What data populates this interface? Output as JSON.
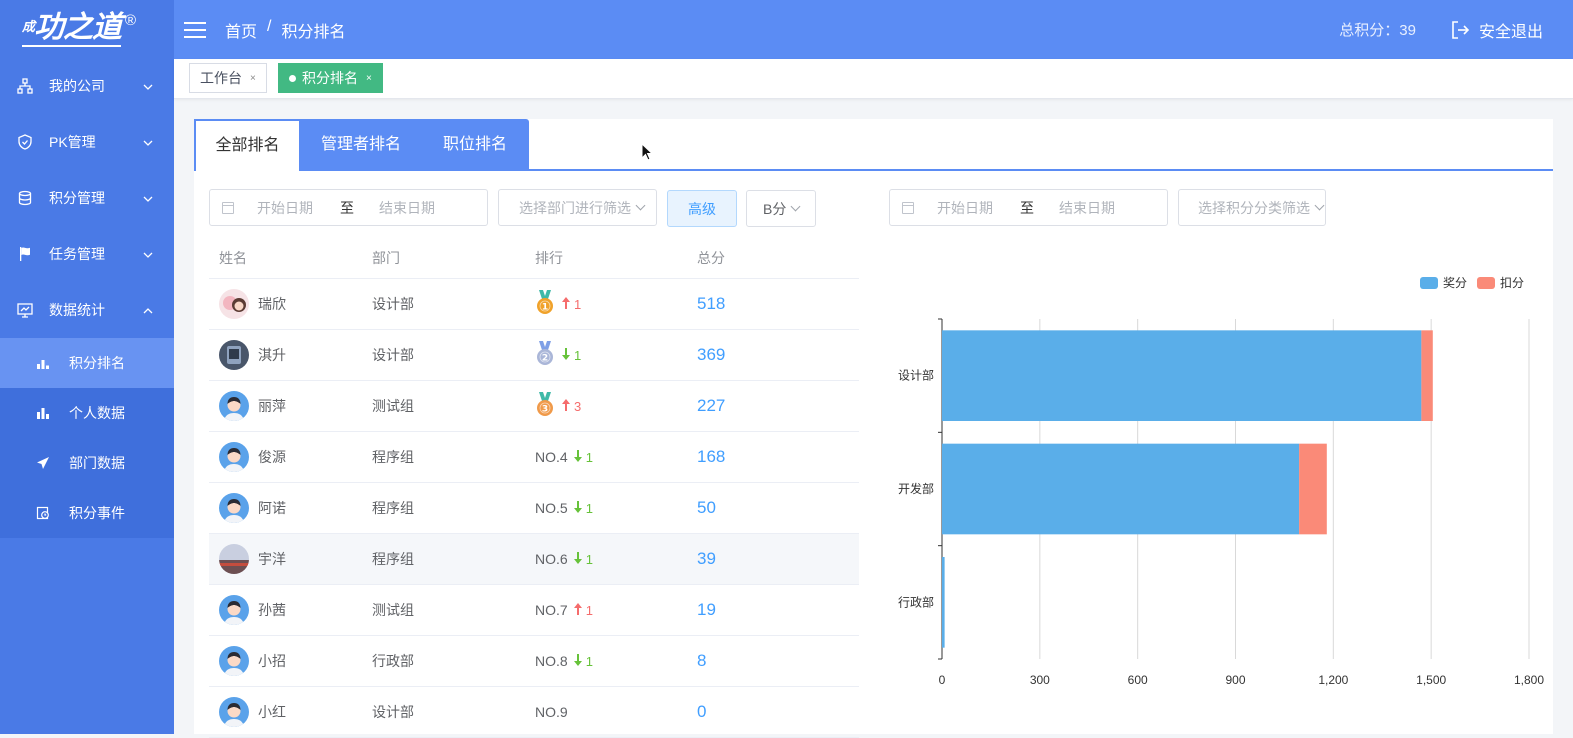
{
  "logo": {
    "text": "功之道",
    "prefix": "成",
    "reg": "®"
  },
  "sidebar": {
    "items": [
      {
        "label": "我的公司",
        "icon": "org-chart-icon"
      },
      {
        "label": "PK管理",
        "icon": "shield-icon"
      },
      {
        "label": "积分管理",
        "icon": "database-icon"
      },
      {
        "label": "任务管理",
        "icon": "flag-icon"
      },
      {
        "label": "数据统计",
        "icon": "dashboard-icon"
      }
    ],
    "subitems": [
      {
        "label": "积分排名",
        "icon": "ranking-icon"
      },
      {
        "label": "个人数据",
        "icon": "bar-chart-icon"
      },
      {
        "label": "部门数据",
        "icon": "send-icon"
      },
      {
        "label": "积分事件",
        "icon": "event-icon"
      }
    ]
  },
  "header": {
    "breadcrumb": [
      "首页",
      "/",
      "积分排名"
    ],
    "total": "总积分：39",
    "logout": "安全退出"
  },
  "tags": [
    {
      "label": "工作台",
      "close": "×"
    },
    {
      "label": "积分排名",
      "close": "×"
    }
  ],
  "tabs": [
    "全部排名",
    "管理者排名",
    "职位排名"
  ],
  "filters": {
    "start": "开始日期",
    "to": "至",
    "end": "结束日期",
    "dept": "选择部门进行筛选",
    "advanced": "高级",
    "type": "B分",
    "category": "选择积分分类筛选"
  },
  "table": {
    "headers": [
      "姓名",
      "部门",
      "排行",
      "总分"
    ],
    "rows": [
      {
        "name": "瑞欣",
        "dept": "设计部",
        "rank": "",
        "medal": "1",
        "trend": "up",
        "change": "1",
        "score": "518"
      },
      {
        "name": "淇升",
        "dept": "设计部",
        "rank": "",
        "medal": "2",
        "trend": "down",
        "change": "1",
        "score": "369"
      },
      {
        "name": "丽萍",
        "dept": "测试组",
        "rank": "",
        "medal": "3",
        "trend": "up",
        "change": "3",
        "score": "227"
      },
      {
        "name": "俊源",
        "dept": "程序组",
        "rank": "NO.4",
        "medal": "",
        "trend": "down",
        "change": "1",
        "score": "168"
      },
      {
        "name": "阿诺",
        "dept": "程序组",
        "rank": "NO.5",
        "medal": "",
        "trend": "down",
        "change": "1",
        "score": "50"
      },
      {
        "name": "宇洋",
        "dept": "程序组",
        "rank": "NO.6",
        "medal": "",
        "trend": "down",
        "change": "1",
        "score": "39"
      },
      {
        "name": "孙茜",
        "dept": "测试组",
        "rank": "NO.7",
        "medal": "",
        "trend": "up",
        "change": "1",
        "score": "19"
      },
      {
        "name": "小招",
        "dept": "行政部",
        "rank": "NO.8",
        "medal": "",
        "trend": "down",
        "change": "1",
        "score": "8"
      },
      {
        "name": "小红",
        "dept": "设计部",
        "rank": "NO.9",
        "medal": "",
        "trend": "",
        "change": "",
        "score": "0"
      }
    ]
  },
  "chart_data": {
    "type": "bar",
    "orientation": "horizontal",
    "stacked": true,
    "categories": [
      "设计部",
      "开发部",
      "行政部"
    ],
    "series": [
      {
        "name": "奖分",
        "color": "#5aaee9",
        "values": [
          1470,
          1095,
          8
        ]
      },
      {
        "name": "扣分",
        "color": "#fa8a78",
        "values": [
          35,
          85,
          0
        ]
      }
    ],
    "xticks": [
      "0",
      "300",
      "600",
      "900",
      "1,200",
      "1,500",
      "1,800"
    ],
    "xlim": [
      0,
      1800
    ],
    "grid": true,
    "legend": "top-right"
  }
}
